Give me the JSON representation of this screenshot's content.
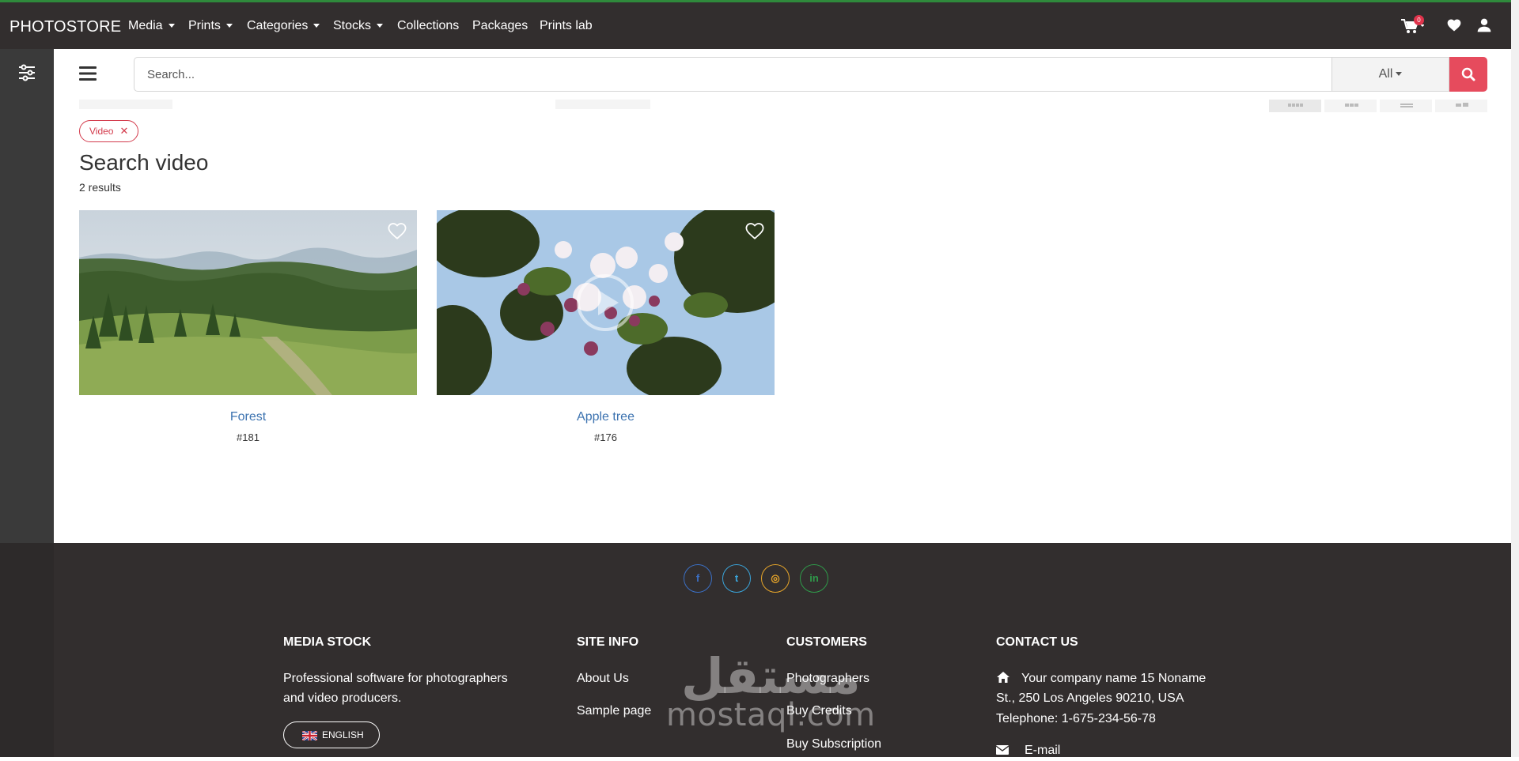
{
  "brand": "PHOTOSTORE",
  "nav": {
    "items": [
      {
        "label": "Media",
        "dropdown": true
      },
      {
        "label": "Prints",
        "dropdown": true
      },
      {
        "label": "Categories",
        "dropdown": true
      },
      {
        "label": "Stocks",
        "dropdown": true
      },
      {
        "label": "Collections",
        "dropdown": false
      },
      {
        "label": "Packages",
        "dropdown": false
      },
      {
        "label": "Prints lab",
        "dropdown": false
      }
    ],
    "cart_count": "0",
    "icons": [
      "cart-icon",
      "heart-icon",
      "user-icon"
    ]
  },
  "search": {
    "placeholder": "Search...",
    "value": "",
    "scope": "All",
    "button_icon": "search-icon"
  },
  "filter_chip": {
    "label": "Video",
    "remove": "✕"
  },
  "page": {
    "title": "Search video",
    "results": "2 results"
  },
  "items": [
    {
      "title": "Forest",
      "id": "#181",
      "thumb": "forest landscape"
    },
    {
      "title": "Apple tree",
      "id": "#176",
      "thumb": "apple blossom"
    }
  ],
  "footer": {
    "social": [
      {
        "icon": "facebook-icon",
        "glyph": "f",
        "color": "#3b6fc4"
      },
      {
        "icon": "twitter-icon",
        "glyph": "t",
        "color": "#3aa3d8"
      },
      {
        "icon": "instagram-icon",
        "glyph": "◎",
        "color": "#e5a42a"
      },
      {
        "icon": "linkedin-icon",
        "glyph": "in",
        "color": "#2f9a4a"
      }
    ],
    "media_stock": {
      "heading": "MEDIA STOCK",
      "line1": "Professional software for photographers",
      "line2": "and video producers.",
      "language": "ENGLISH"
    },
    "site_info": {
      "heading": "SITE INFO",
      "links": [
        "About Us",
        "Sample page"
      ]
    },
    "customers": {
      "heading": "CUSTOMERS",
      "links": [
        "Photographers",
        "Buy Credits",
        "Buy Subscription"
      ]
    },
    "contact": {
      "heading": "CONTACT US",
      "address1": "Your company name 15 Noname",
      "address2": "St., 250 Los Angeles 90210, USA",
      "phone": "Telephone: 1-675-234-56-78",
      "email": "E-mail"
    },
    "watermark": {
      "arabic": "مستقل",
      "latin": "mostaql.com"
    }
  },
  "colors": {
    "accent": "#e64b5d",
    "link": "#3d73b0",
    "navbar": "#322e2e",
    "topline": "#2f8a3c"
  }
}
